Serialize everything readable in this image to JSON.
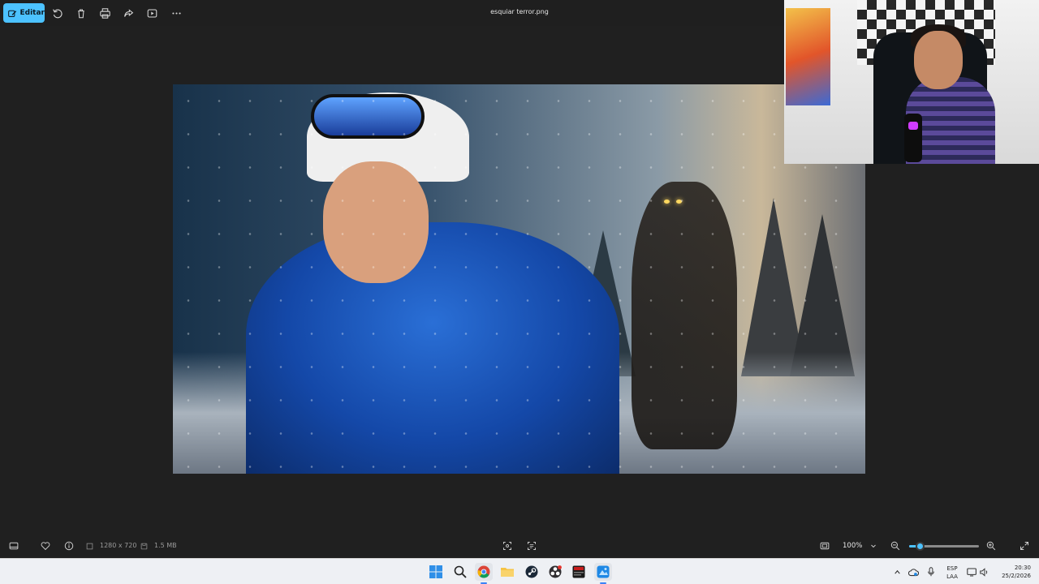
{
  "toolbar": {
    "edit_label": "Editar",
    "icons": [
      "rotate-icon",
      "delete-icon",
      "print-icon",
      "share-icon",
      "slideshow-icon",
      "more-icon"
    ]
  },
  "window": {
    "title": "esquiar terror.png"
  },
  "statusbar": {
    "dimensions": "1280 x 720",
    "file_size": "1.5 MB",
    "zoom": "100%",
    "zoom_level_fraction": 0.15
  },
  "taskbar": {
    "apps": [
      "start",
      "search",
      "chrome",
      "file-explorer",
      "steam",
      "obs",
      "game-app",
      "photos"
    ],
    "language": {
      "line1": "ESP",
      "line2": "LAA"
    },
    "clock": {
      "time": "20:30",
      "date": "25/2/2026"
    }
  },
  "colors": {
    "accent": "#4cc2ff",
    "background": "#1f1f1f",
    "taskbar": "#eef0f4"
  }
}
